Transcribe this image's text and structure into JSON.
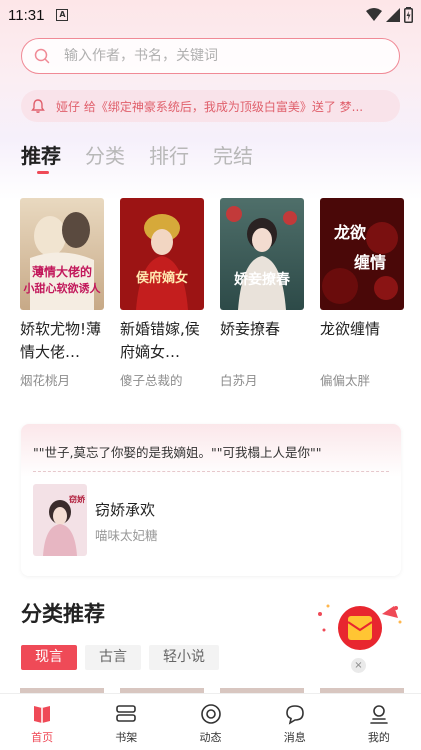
{
  "status_bar": {
    "time": "11:31",
    "notification_letter": "A"
  },
  "search": {
    "placeholder": "输入作者，书名，关键词"
  },
  "notice": {
    "text": "娅仔 给《绑定神豪系统后，我成为顶级白富美》送了 梦..."
  },
  "tabs": [
    {
      "label": "推荐",
      "active": true
    },
    {
      "label": "分类",
      "active": false
    },
    {
      "label": "排行",
      "active": false
    },
    {
      "label": "完结",
      "active": false
    }
  ],
  "books": [
    {
      "title": "娇软尤物!薄情大佬…",
      "author": "烟花桃月",
      "cover_text": "薄情大佬的小甜心软欲诱人"
    },
    {
      "title": "新婚错嫁,侯府嫡女…",
      "author": "傻子总裁的",
      "cover_text": "侯府嫡女"
    },
    {
      "title": "娇妾撩春",
      "author": "白苏月",
      "cover_text": "娇妾撩春"
    },
    {
      "title": "龙欲缠情",
      "author": "偏偏太胖",
      "cover_text": "龙欲缠情"
    }
  ],
  "quote": {
    "text": "\"\"世子,莫忘了你娶的是我嫡姐。\"\"可我榻上人是你\"\"",
    "book_title": "窃娇承欢",
    "book_author": "喵味太妃糖",
    "cover_text": "窃娇承欢"
  },
  "category": {
    "title": "分类推荐",
    "tabs": [
      {
        "label": "现言",
        "active": true
      },
      {
        "label": "古言",
        "active": false
      },
      {
        "label": "轻小说",
        "active": false
      }
    ]
  },
  "float_ad": {
    "close_symbol": "×"
  },
  "bottom_nav": [
    {
      "label": "首页",
      "icon": "home-book-icon",
      "active": true
    },
    {
      "label": "书架",
      "icon": "bookshelf-icon",
      "active": false
    },
    {
      "label": "动态",
      "icon": "dynamic-icon",
      "active": false
    },
    {
      "label": "消息",
      "icon": "message-icon",
      "active": false
    },
    {
      "label": "我的",
      "icon": "profile-icon",
      "active": false
    }
  ],
  "colors": {
    "accent": "#ef4a57",
    "notice_text": "#e0606c",
    "search_border": "#f08a96"
  }
}
